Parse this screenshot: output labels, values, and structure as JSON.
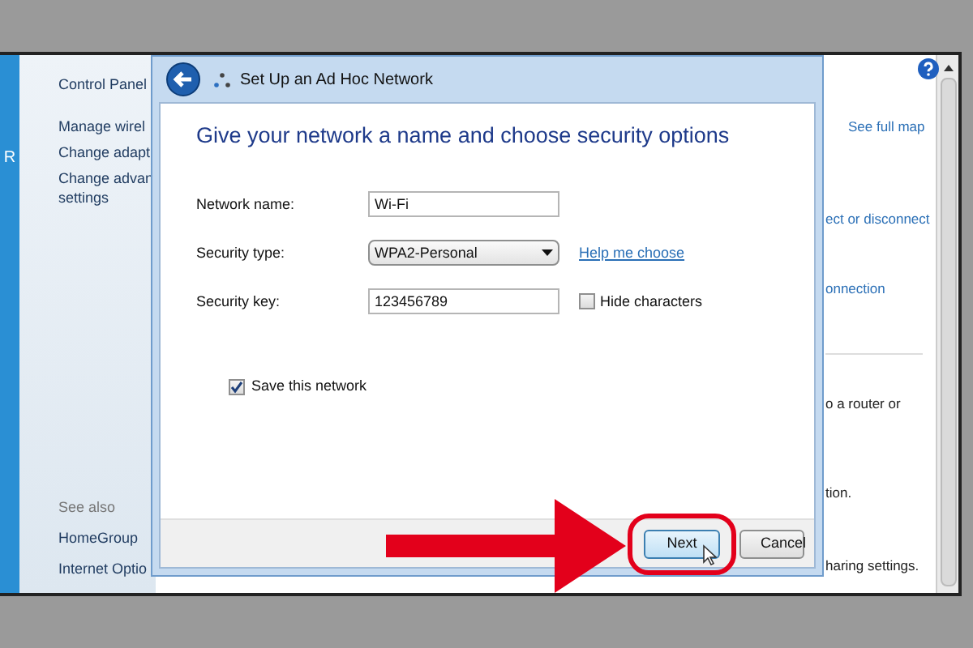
{
  "sidebar": {
    "edge_text": "R",
    "title": "Control Panel",
    "links": [
      {
        "lines": [
          "Manage wirel"
        ]
      },
      {
        "lines": [
          "Change adapt"
        ]
      },
      {
        "lines": [
          "Change advan",
          "settings"
        ]
      }
    ],
    "see_also": {
      "heading": "See also",
      "links": [
        "HomeGroup",
        "Internet Optio"
      ]
    }
  },
  "background_pane": {
    "items": [
      {
        "kind": "link",
        "text": "See full map"
      },
      {
        "kind": "link",
        "text": "ect or disconnect"
      },
      {
        "kind": "link",
        "text": "onnection"
      },
      {
        "kind": "text",
        "text": "o a router or"
      },
      {
        "kind": "text",
        "text": "tion."
      },
      {
        "kind": "text",
        "text": "haring settings."
      }
    ]
  },
  "dialog": {
    "title": "Set Up an Ad Hoc Network",
    "heading": "Give your network a name and choose security options",
    "fields": [
      {
        "kind": "text",
        "label": "Network name:",
        "value": "Wi-Fi"
      },
      {
        "kind": "dropdown",
        "label": "Security type:",
        "value": "WPA2-Personal",
        "link": "Help me choose"
      },
      {
        "kind": "text",
        "label": "Security key:",
        "value": "123456789",
        "checkbox": {
          "label": "Hide characters",
          "checked": false
        }
      }
    ],
    "save": {
      "label": "Save this network",
      "checked": true
    },
    "buttons": [
      {
        "label": "Next",
        "highlighted": true
      },
      {
        "label": "Cancel",
        "highlighted": false
      }
    ]
  }
}
